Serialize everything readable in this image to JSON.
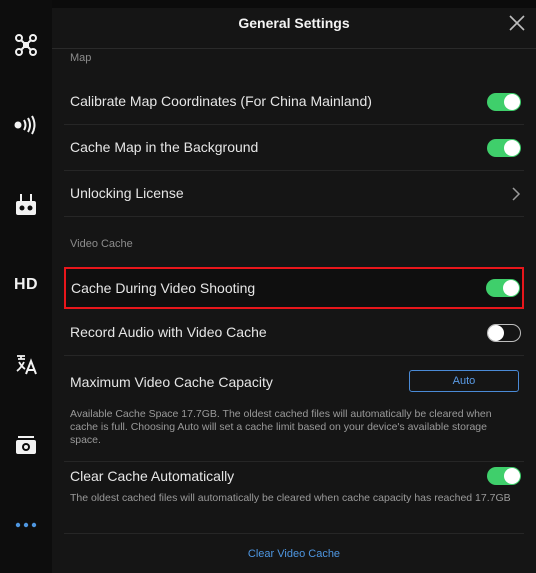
{
  "header": {
    "title": "General Settings"
  },
  "sidebar": {
    "items": [
      {
        "name": "aircraft-icon"
      },
      {
        "name": "signal-icon"
      },
      {
        "name": "remote-controller-icon"
      },
      {
        "name": "hd-icon",
        "label": "HD"
      },
      {
        "name": "language-icon"
      },
      {
        "name": "camera-icon"
      },
      {
        "name": "more-icon"
      }
    ]
  },
  "map_section": {
    "label": "Map",
    "calibrate": {
      "label": "Calibrate Map Coordinates (For China Mainland)",
      "on": true
    },
    "cache_bg": {
      "label": "Cache Map in the Background",
      "on": true
    },
    "license": {
      "label": "Unlocking License"
    }
  },
  "video_section": {
    "label": "Video Cache",
    "cache_during": {
      "label": "Cache During Video Shooting",
      "on": true
    },
    "record_audio": {
      "label": "Record Audio with Video Cache",
      "on": false
    },
    "max_capacity": {
      "label": "Maximum Video Cache Capacity",
      "value": "Auto"
    },
    "available_desc": "Available Cache Space 17.7GB. The oldest cached files will automatically be cleared when cache is full. Choosing Auto will set a cache limit based on your device's available storage space.",
    "clear_auto": {
      "label": "Clear Cache Automatically",
      "on": true
    },
    "clear_desc": "The oldest cached files will automatically be cleared when cache capacity has reached 17.7GB",
    "clear_link": "Clear Video Cache"
  },
  "colors": {
    "accent": "#3fcf6b",
    "link": "#4e96e0",
    "highlight": "#e8161b",
    "background": "#151515"
  }
}
